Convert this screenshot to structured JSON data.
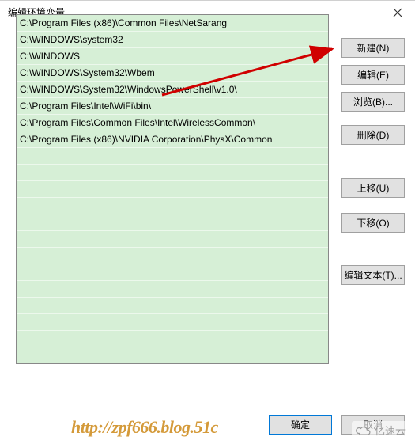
{
  "title": "编辑环境变量",
  "paths": [
    "C:\\Program Files (x86)\\Common Files\\NetSarang",
    "C:\\WINDOWS\\system32",
    "C:\\WINDOWS",
    "C:\\WINDOWS\\System32\\Wbem",
    "C:\\WINDOWS\\System32\\WindowsPowerShell\\v1.0\\",
    "C:\\Program Files\\Intel\\WiFi\\bin\\",
    "C:\\Program Files\\Common Files\\Intel\\WirelessCommon\\",
    "C:\\Program Files (x86)\\NVIDIA Corporation\\PhysX\\Common"
  ],
  "buttons": {
    "new": "新建(N)",
    "edit": "编辑(E)",
    "browse": "浏览(B)...",
    "delete": "删除(D)",
    "moveup": "上移(U)",
    "movedown": "下移(O)",
    "edittext": "编辑文本(T)...",
    "ok": "确定",
    "cancel": "取消"
  },
  "watermark": {
    "url": "http://zpf666.blog.51c",
    "logo_text": "亿速云"
  }
}
